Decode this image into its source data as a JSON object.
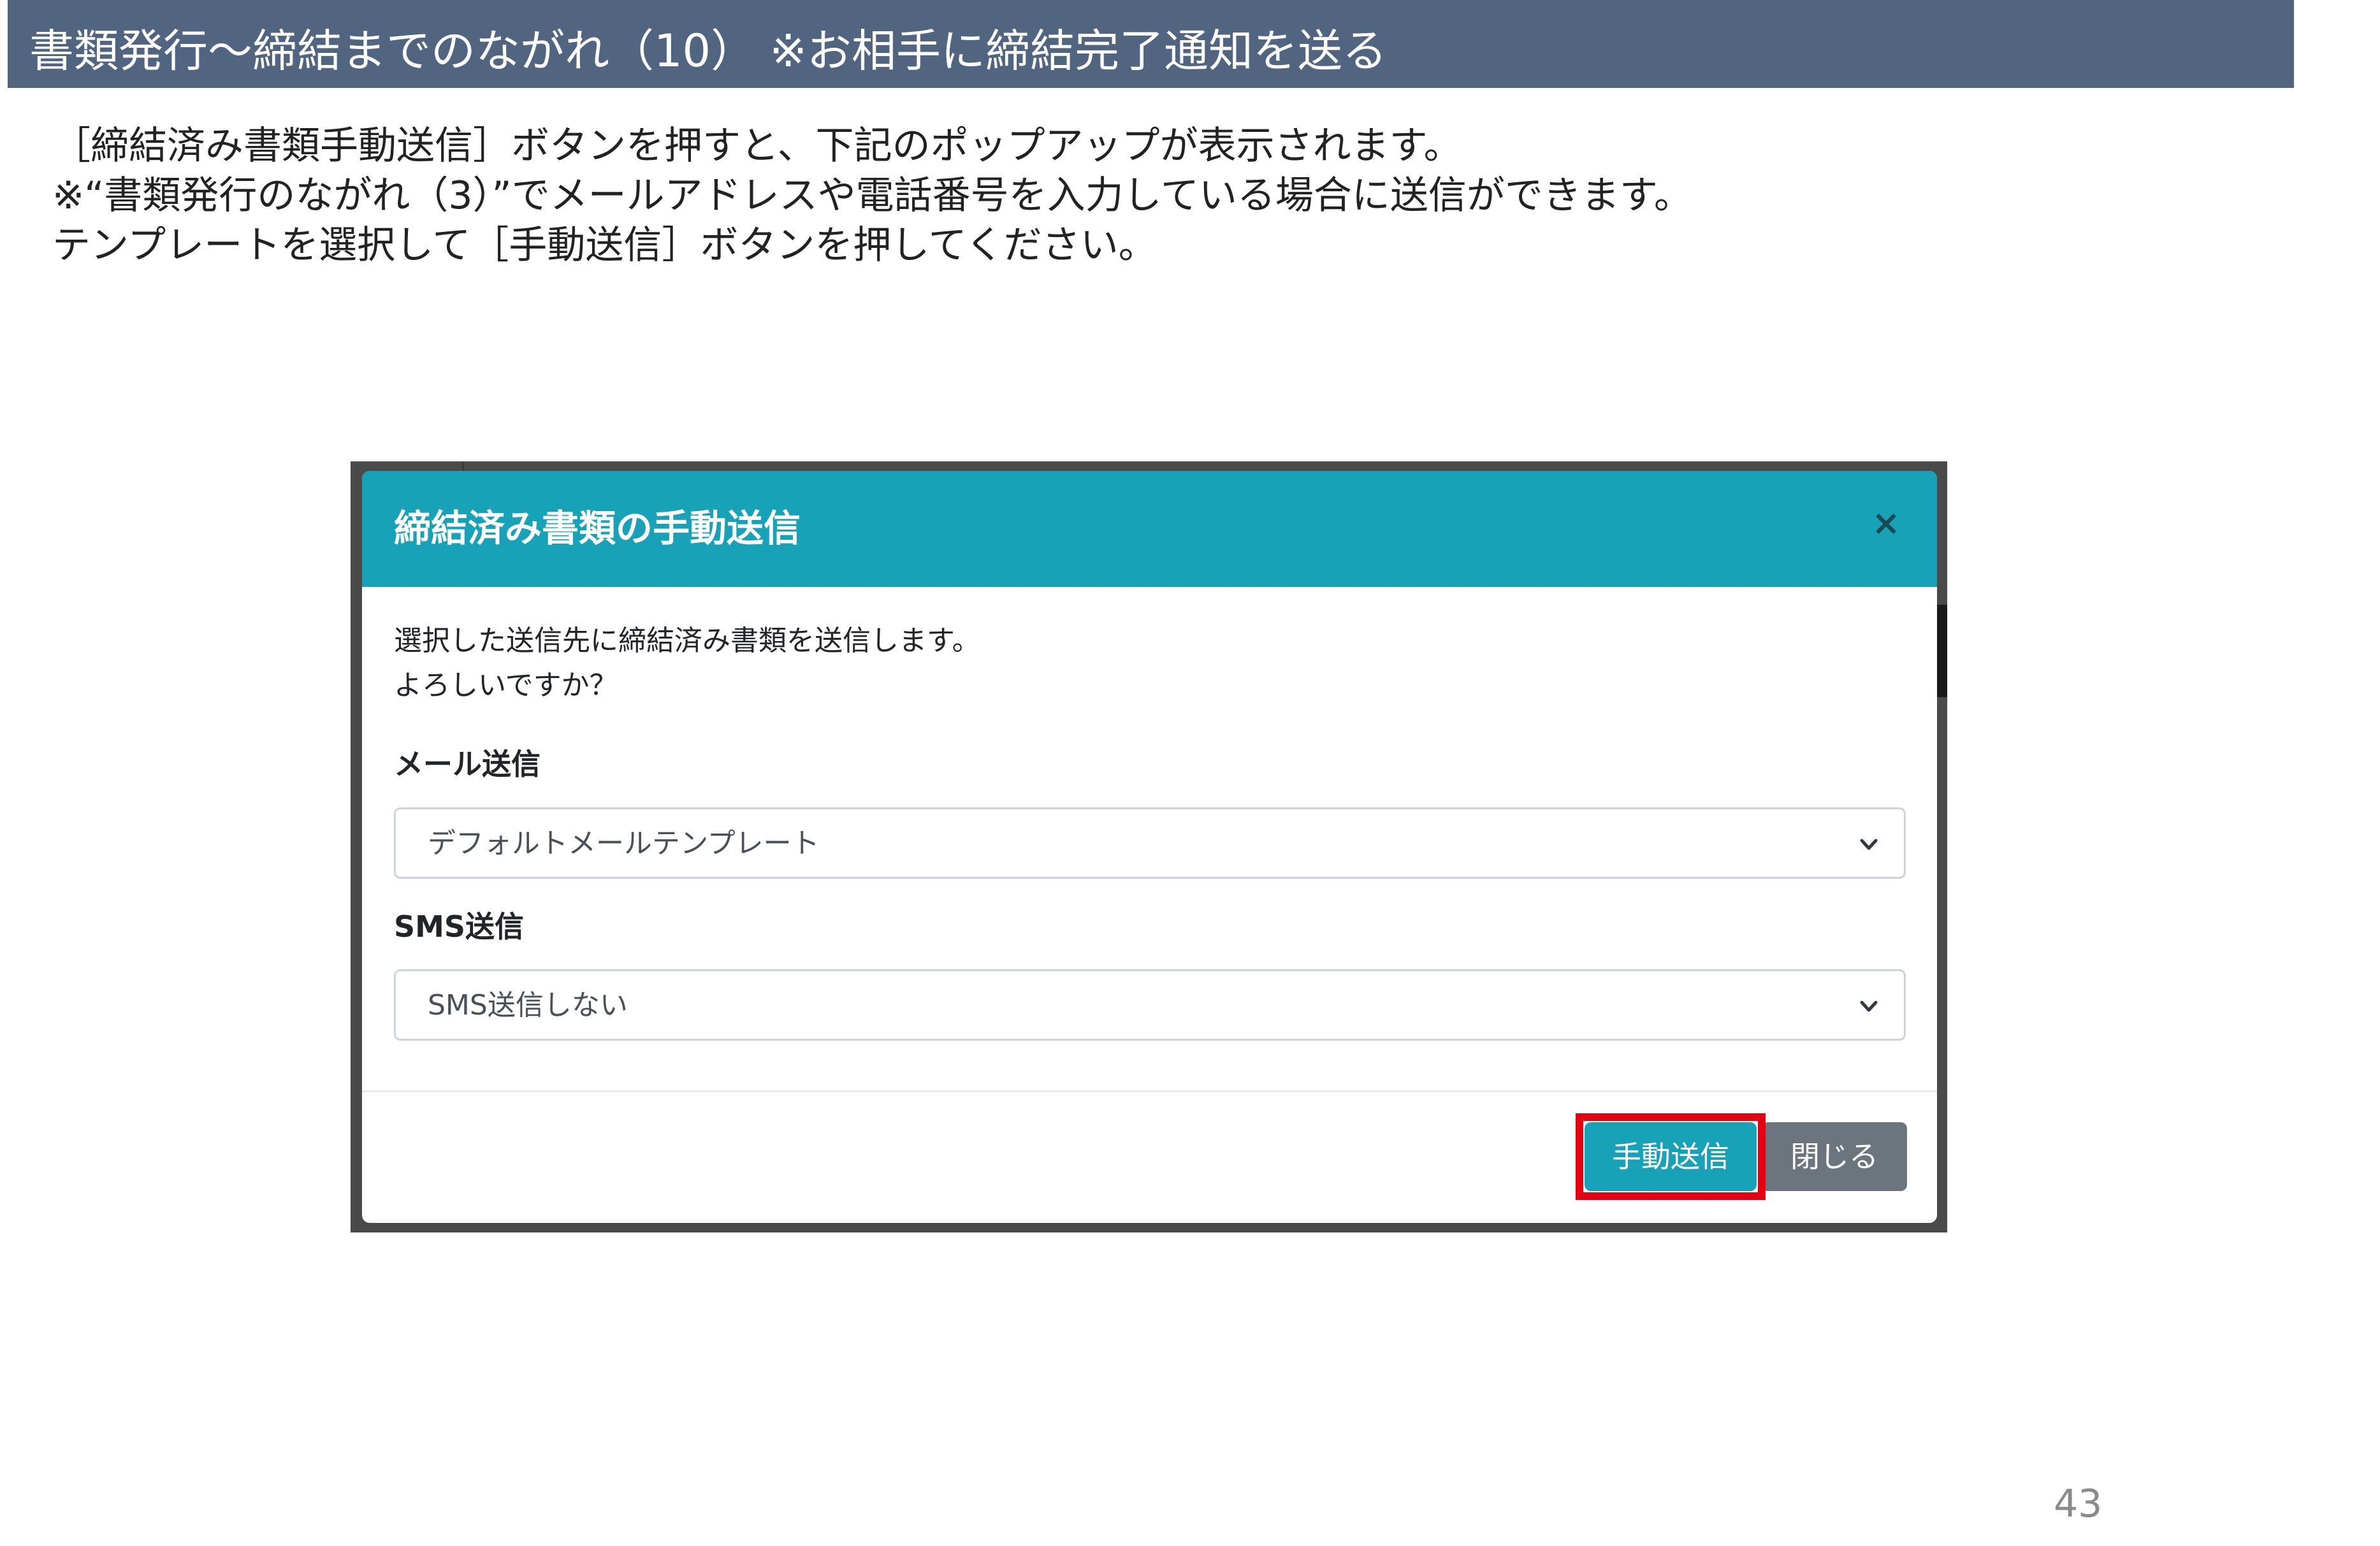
{
  "slide": {
    "title": "書類発行～締結までのながれ（10）  ※お相手に締結完了通知を送る",
    "intro_lines": [
      "［締結済み書類手動送信］ボタンを押すと、下記のポップアップが表示されます。",
      "※“書類発行のながれ（3）”でメールアドレスや電話番号を入力している場合に送信ができます。",
      "テンプレートを選択して［手動送信］ボタンを押してください。"
    ],
    "page_number": "43",
    "header_color": "#516581",
    "highlight_color": "#e50012"
  },
  "modal": {
    "title": "締結済み書類の手動送信",
    "close_icon": "×",
    "body_lines": [
      "選択した送信先に締結済み書類を送信します。",
      "よろしいですか？"
    ],
    "email": {
      "label": "メール送信",
      "selected": "デフォルトメールテンプレート"
    },
    "sms": {
      "label": "SMS送信",
      "selected": "SMS送信しない"
    },
    "buttons": {
      "send": "手動送信",
      "close": "閉じる"
    },
    "accent_color": "#17a2b8",
    "secondary_color": "#6c757d"
  }
}
